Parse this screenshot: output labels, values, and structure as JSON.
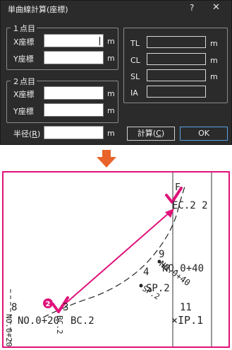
{
  "dialog": {
    "title": "単曲線計算(座標)",
    "help": "?",
    "close": "✕",
    "point1": {
      "label": "１点目",
      "x_label": "X座標",
      "y_label": "Y座標",
      "x_value": "",
      "y_value": "",
      "unit": "m"
    },
    "point2": {
      "label": "２点目",
      "x_label": "X座標",
      "y_label": "Y座標",
      "x_value": "",
      "y_value": "",
      "unit": "m"
    },
    "radius": {
      "label_pre": "半径(",
      "label_key": "R",
      "label_post": ")",
      "value": "",
      "unit": "m"
    },
    "results": [
      {
        "label": "TL",
        "value": "",
        "unit": "m"
      },
      {
        "label": "CL",
        "value": "",
        "unit": "m"
      },
      {
        "label": "SL",
        "value": "",
        "unit": "m"
      },
      {
        "label": "IA",
        "value": ""
      }
    ],
    "calc_button": {
      "pre": "計算(",
      "key": "C",
      "post": ")"
    },
    "ok_button": "OK"
  },
  "arrow_color": "#e8642a",
  "drawing": {
    "border_color": "#e0127a",
    "pick_color": "#e0127a",
    "labels": {
      "ec": "EC.2 2",
      "f": "F",
      "no9": "9",
      "no4": "4",
      "no_main": "NO.0+40",
      "no_rot": "NO.0+40",
      "sp_main": "SP.2",
      "sp_rot": "SP.2",
      "n8": "8",
      "n3": "3",
      "no_bc": "NO.0+20",
      "bc": "BC.2",
      "bc_rot": "BC.2",
      "left_rot": "NO.0+20",
      "n11": "11",
      "ip": "×IP.1"
    },
    "badge": "2"
  }
}
